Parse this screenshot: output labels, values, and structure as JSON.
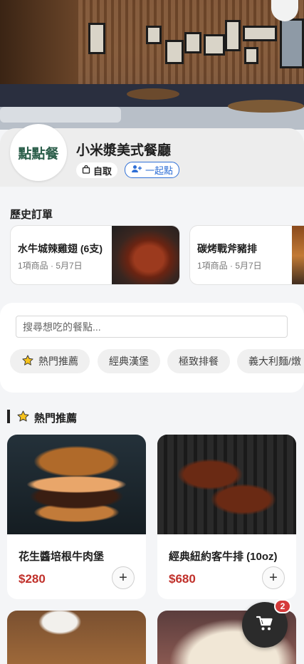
{
  "restaurant": {
    "logo_text": "點點餐",
    "name": "小米漿美式餐廳",
    "takeout_label": "自取",
    "group_order_label": "一起點"
  },
  "history": {
    "title": "歷史訂單",
    "orders": [
      {
        "name": "水牛城辣雞翅 (6支)",
        "meta": "1項商品 · 5月7日"
      },
      {
        "name": "碳烤戰斧豬排",
        "meta": "1項商品 · 5月7日"
      }
    ]
  },
  "search": {
    "placeholder": "搜尋想吃的餐點..."
  },
  "categories": [
    "熱門推薦",
    "經典漢堡",
    "極致排餐",
    "義大利麵/燉"
  ],
  "featured": {
    "title": "熱門推薦",
    "products": [
      {
        "name": "花生醬培根牛肉堡",
        "price": "$280"
      },
      {
        "name": "經典紐約客牛排 (10oz)",
        "price": "$680"
      }
    ]
  },
  "cart": {
    "count": "2"
  },
  "colors": {
    "accent_blue": "#2f6fd6",
    "price_red": "#c0302a",
    "badge_red": "#d53a3a"
  }
}
